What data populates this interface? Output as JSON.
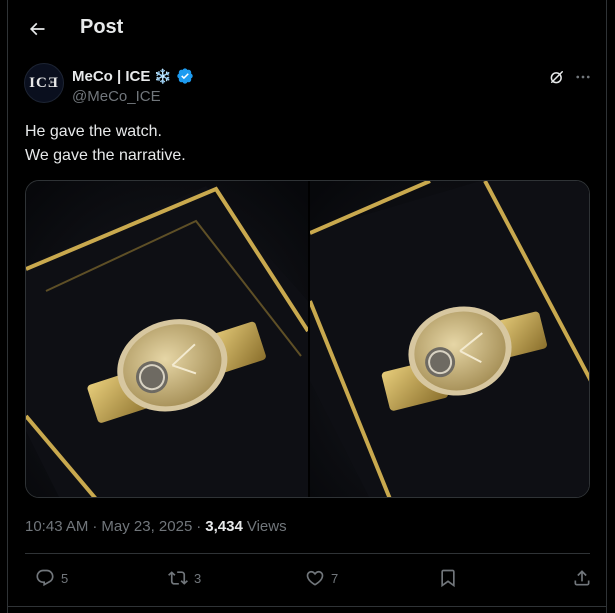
{
  "header": {
    "title": "Post",
    "back_icon": "arrow-left-icon"
  },
  "author": {
    "avatar_text": "ICƎ",
    "display_name": "MeCo | ICE",
    "emoji": "❄️",
    "handle": "@MeCo_ICE",
    "verified_color": "#1d9bf0"
  },
  "tweet": {
    "lines": [
      "He gave the watch.",
      "We gave the narrative."
    ]
  },
  "meta": {
    "time": "10:43 AM",
    "sep1": "·",
    "date": "May 23, 2025",
    "sep2": "·",
    "views_count": "3,434",
    "views_label": "Views"
  },
  "actions": {
    "replies": "5",
    "reposts": "3",
    "likes": "7"
  },
  "colors": {
    "background": "#000000",
    "text": "#e7e9ea",
    "muted": "#71767b",
    "border": "#2f3336",
    "accent": "#1d9bf0",
    "gold": "#c9a94e"
  }
}
